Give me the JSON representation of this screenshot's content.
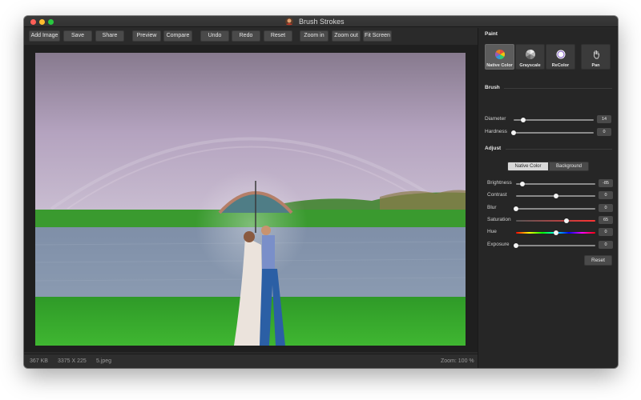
{
  "window": {
    "title": "Brush Strokes"
  },
  "toolbar": {
    "add_image": "Add Image",
    "save": "Save",
    "share": "Share",
    "preview": "Preview",
    "compare": "Compare",
    "undo": "Undo",
    "redo": "Redo",
    "reset": "Reset",
    "zoom_in": "Zoom in",
    "zoom_out": "Zoom out",
    "fit_screen": "Fit Screen"
  },
  "status": {
    "file_size": "367 KB",
    "dimensions": "3375 X 225",
    "filename": "5.jpeg",
    "zoom": "Zoom: 100 %"
  },
  "panel": {
    "paint": {
      "title": "Paint",
      "modes": [
        {
          "label": "Native Color",
          "icon": "color-wheel-icon",
          "active": true
        },
        {
          "label": "Grayscale",
          "icon": "grayscale-wheel-icon",
          "active": false
        },
        {
          "label": "ReColor",
          "icon": "recolor-circle-icon",
          "active": false
        }
      ],
      "pan": {
        "label": "Pan",
        "icon": "hand-icon"
      }
    },
    "brush": {
      "title": "Brush",
      "diameter": {
        "label": "Diameter",
        "value": "14",
        "fraction": 0.12
      },
      "hardness": {
        "label": "Hardness",
        "value": "0",
        "fraction": 0.0
      }
    },
    "adjust": {
      "title": "Adjust",
      "segments": {
        "native": "Native Color",
        "background": "Background"
      },
      "brightness": {
        "label": "Brightness",
        "value": "-85",
        "fraction": 0.08
      },
      "contrast": {
        "label": "Contrast",
        "value": "0",
        "fraction": 0.5
      },
      "blur": {
        "label": "Blur",
        "value": "0",
        "fraction": 0.0
      },
      "saturation": {
        "label": "Saturation",
        "value": "65",
        "fraction": 0.64
      },
      "hue": {
        "label": "Hue",
        "value": "0",
        "fraction": 0.5
      },
      "exposure": {
        "label": "Exposure",
        "value": "0",
        "fraction": 0.0
      },
      "reset": "Reset"
    }
  },
  "colors": {
    "window_bg": "#2a2a2a",
    "panel_bg": "#262626",
    "button_bg": "#4a4a4a",
    "active_mode_bg": "#5c5c5c"
  }
}
